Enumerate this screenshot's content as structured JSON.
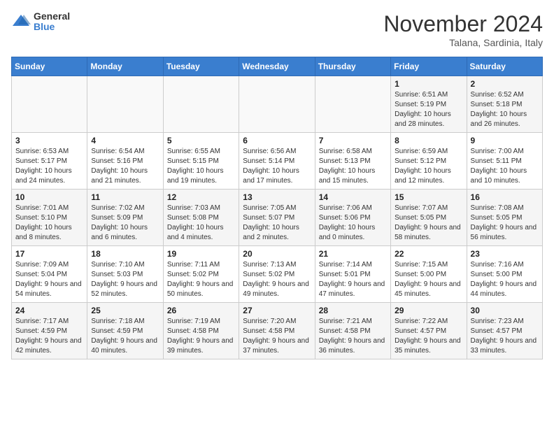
{
  "logo": {
    "general": "General",
    "blue": "Blue"
  },
  "header": {
    "month_title": "November 2024",
    "location": "Talana, Sardinia, Italy"
  },
  "weekdays": [
    "Sunday",
    "Monday",
    "Tuesday",
    "Wednesday",
    "Thursday",
    "Friday",
    "Saturday"
  ],
  "weeks": [
    [
      {
        "day": "",
        "info": ""
      },
      {
        "day": "",
        "info": ""
      },
      {
        "day": "",
        "info": ""
      },
      {
        "day": "",
        "info": ""
      },
      {
        "day": "",
        "info": ""
      },
      {
        "day": "1",
        "info": "Sunrise: 6:51 AM\nSunset: 5:19 PM\nDaylight: 10 hours and 28 minutes."
      },
      {
        "day": "2",
        "info": "Sunrise: 6:52 AM\nSunset: 5:18 PM\nDaylight: 10 hours and 26 minutes."
      }
    ],
    [
      {
        "day": "3",
        "info": "Sunrise: 6:53 AM\nSunset: 5:17 PM\nDaylight: 10 hours and 24 minutes."
      },
      {
        "day": "4",
        "info": "Sunrise: 6:54 AM\nSunset: 5:16 PM\nDaylight: 10 hours and 21 minutes."
      },
      {
        "day": "5",
        "info": "Sunrise: 6:55 AM\nSunset: 5:15 PM\nDaylight: 10 hours and 19 minutes."
      },
      {
        "day": "6",
        "info": "Sunrise: 6:56 AM\nSunset: 5:14 PM\nDaylight: 10 hours and 17 minutes."
      },
      {
        "day": "7",
        "info": "Sunrise: 6:58 AM\nSunset: 5:13 PM\nDaylight: 10 hours and 15 minutes."
      },
      {
        "day": "8",
        "info": "Sunrise: 6:59 AM\nSunset: 5:12 PM\nDaylight: 10 hours and 12 minutes."
      },
      {
        "day": "9",
        "info": "Sunrise: 7:00 AM\nSunset: 5:11 PM\nDaylight: 10 hours and 10 minutes."
      }
    ],
    [
      {
        "day": "10",
        "info": "Sunrise: 7:01 AM\nSunset: 5:10 PM\nDaylight: 10 hours and 8 minutes."
      },
      {
        "day": "11",
        "info": "Sunrise: 7:02 AM\nSunset: 5:09 PM\nDaylight: 10 hours and 6 minutes."
      },
      {
        "day": "12",
        "info": "Sunrise: 7:03 AM\nSunset: 5:08 PM\nDaylight: 10 hours and 4 minutes."
      },
      {
        "day": "13",
        "info": "Sunrise: 7:05 AM\nSunset: 5:07 PM\nDaylight: 10 hours and 2 minutes."
      },
      {
        "day": "14",
        "info": "Sunrise: 7:06 AM\nSunset: 5:06 PM\nDaylight: 10 hours and 0 minutes."
      },
      {
        "day": "15",
        "info": "Sunrise: 7:07 AM\nSunset: 5:05 PM\nDaylight: 9 hours and 58 minutes."
      },
      {
        "day": "16",
        "info": "Sunrise: 7:08 AM\nSunset: 5:05 PM\nDaylight: 9 hours and 56 minutes."
      }
    ],
    [
      {
        "day": "17",
        "info": "Sunrise: 7:09 AM\nSunset: 5:04 PM\nDaylight: 9 hours and 54 minutes."
      },
      {
        "day": "18",
        "info": "Sunrise: 7:10 AM\nSunset: 5:03 PM\nDaylight: 9 hours and 52 minutes."
      },
      {
        "day": "19",
        "info": "Sunrise: 7:11 AM\nSunset: 5:02 PM\nDaylight: 9 hours and 50 minutes."
      },
      {
        "day": "20",
        "info": "Sunrise: 7:13 AM\nSunset: 5:02 PM\nDaylight: 9 hours and 49 minutes."
      },
      {
        "day": "21",
        "info": "Sunrise: 7:14 AM\nSunset: 5:01 PM\nDaylight: 9 hours and 47 minutes."
      },
      {
        "day": "22",
        "info": "Sunrise: 7:15 AM\nSunset: 5:00 PM\nDaylight: 9 hours and 45 minutes."
      },
      {
        "day": "23",
        "info": "Sunrise: 7:16 AM\nSunset: 5:00 PM\nDaylight: 9 hours and 44 minutes."
      }
    ],
    [
      {
        "day": "24",
        "info": "Sunrise: 7:17 AM\nSunset: 4:59 PM\nDaylight: 9 hours and 42 minutes."
      },
      {
        "day": "25",
        "info": "Sunrise: 7:18 AM\nSunset: 4:59 PM\nDaylight: 9 hours and 40 minutes."
      },
      {
        "day": "26",
        "info": "Sunrise: 7:19 AM\nSunset: 4:58 PM\nDaylight: 9 hours and 39 minutes."
      },
      {
        "day": "27",
        "info": "Sunrise: 7:20 AM\nSunset: 4:58 PM\nDaylight: 9 hours and 37 minutes."
      },
      {
        "day": "28",
        "info": "Sunrise: 7:21 AM\nSunset: 4:58 PM\nDaylight: 9 hours and 36 minutes."
      },
      {
        "day": "29",
        "info": "Sunrise: 7:22 AM\nSunset: 4:57 PM\nDaylight: 9 hours and 35 minutes."
      },
      {
        "day": "30",
        "info": "Sunrise: 7:23 AM\nSunset: 4:57 PM\nDaylight: 9 hours and 33 minutes."
      }
    ]
  ]
}
